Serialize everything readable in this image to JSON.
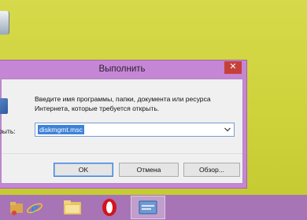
{
  "dialog": {
    "title": "Выполнить",
    "close_glyph": "✕",
    "description_line1": "Введите имя программы, папки, документа или ресурса",
    "description_line2": "Интернета, которые требуется открыть.",
    "open_label": "рыть:",
    "open_value": "diskmgmt.msc",
    "ok_label": "OK",
    "cancel_label": "Отмена",
    "browse_label": "Обзор..."
  },
  "taskbar": {
    "items": [
      {
        "icon": "file-explorer-icon"
      },
      {
        "icon": "internet-explorer-icon"
      },
      {
        "icon": "folder-icon"
      },
      {
        "icon": "opera-icon"
      },
      {
        "icon": "run-dialog-icon",
        "active": true
      }
    ]
  },
  "colors": {
    "desktop": "#cfd43a",
    "window_frame": "#c586d5",
    "taskbar": "#a774b6",
    "close": "#c6403a",
    "accent": "#3e82d8"
  }
}
